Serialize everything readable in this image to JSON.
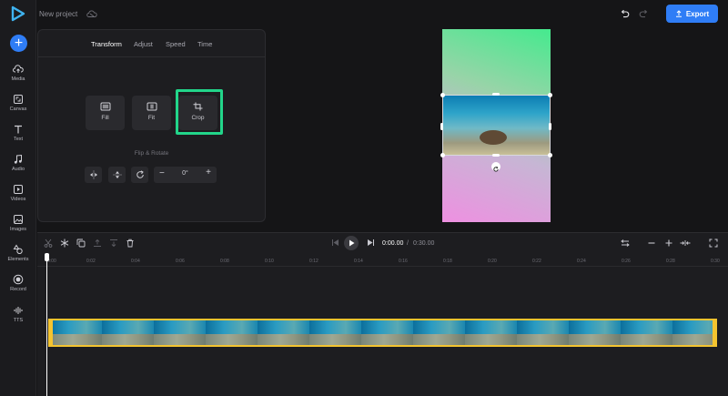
{
  "header": {
    "project_name": "New project",
    "export_label": "Export"
  },
  "sidebar": {
    "items": [
      {
        "label": "Media",
        "icon": "cloud-upload-icon"
      },
      {
        "label": "Canvas",
        "icon": "canvas-icon"
      },
      {
        "label": "Text",
        "icon": "text-icon"
      },
      {
        "label": "Audio",
        "icon": "music-note-icon"
      },
      {
        "label": "Videos",
        "icon": "video-icon"
      },
      {
        "label": "Images",
        "icon": "image-icon"
      },
      {
        "label": "Elements",
        "icon": "shapes-icon"
      },
      {
        "label": "Record",
        "icon": "record-icon"
      },
      {
        "label": "TTS",
        "icon": "waveform-icon"
      }
    ]
  },
  "panel": {
    "tabs": [
      "Transform",
      "Adjust",
      "Speed",
      "Time"
    ],
    "active_tab": "Transform",
    "fit_options": [
      "Fill",
      "Fit",
      "Crop"
    ],
    "flip_rotate_label": "Flip & Rotate",
    "rotation_value": "0°",
    "minus": "−",
    "plus": "+"
  },
  "timeline": {
    "current_time": "0:00.00",
    "separator": "/",
    "total_time": "0:30.00",
    "ruler_ticks": [
      "0:00",
      "0:02",
      "0:04",
      "0:06",
      "0:08",
      "0:10",
      "0:12",
      "0:14",
      "0:16",
      "0:18",
      "0:20",
      "0:22",
      "0:24",
      "0:26",
      "0:28",
      "0:30"
    ]
  },
  "colors": {
    "accent": "#2f7df6",
    "crop_highlight": "#22d58a",
    "clip_border": "#f4c430"
  }
}
